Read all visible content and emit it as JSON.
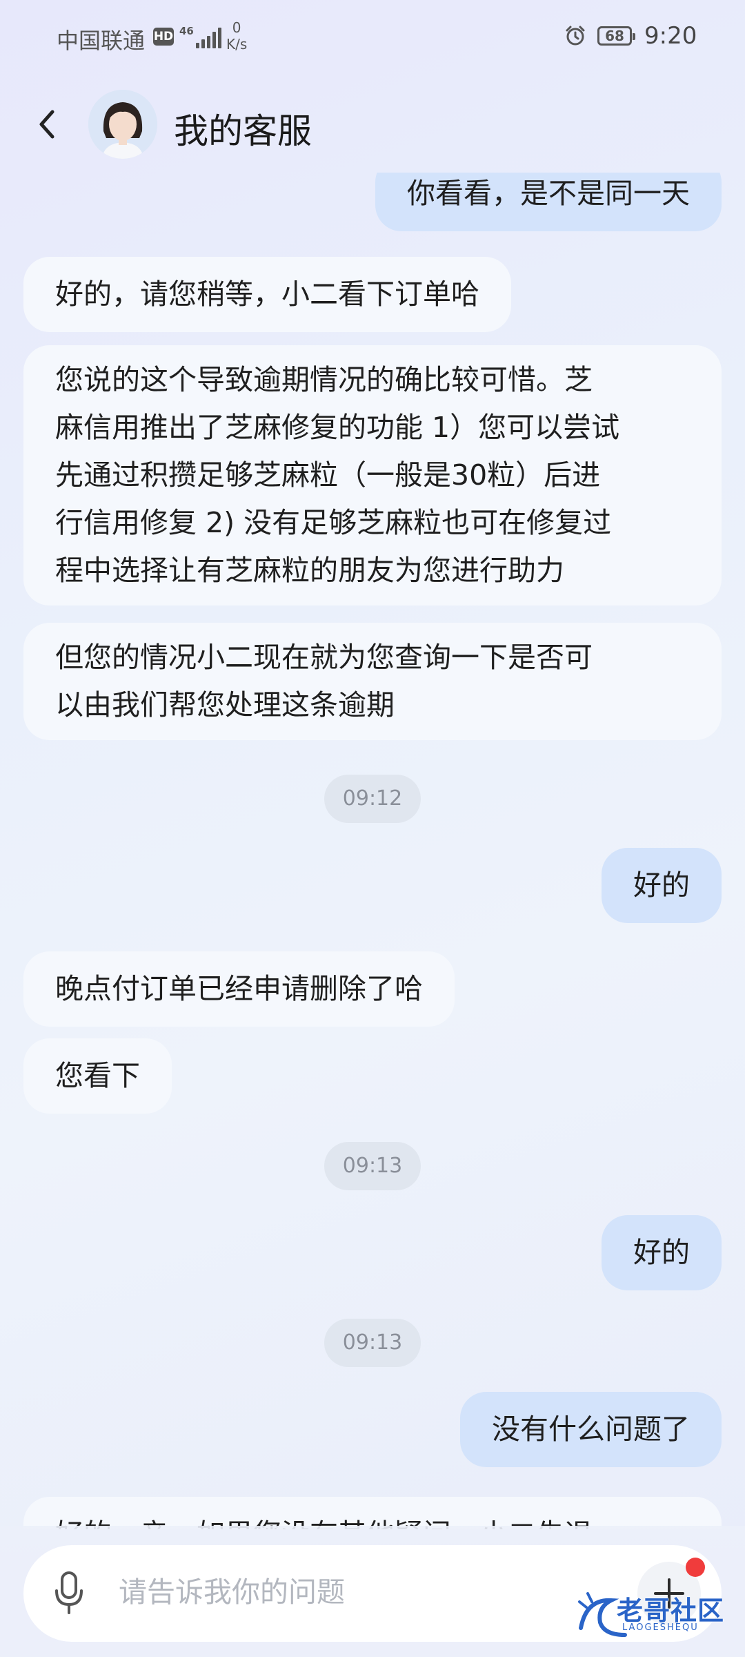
{
  "status_bar": {
    "carrier": "中国联通",
    "hd": "HD",
    "network": "46",
    "speed_value": "0",
    "speed_unit": "K/s",
    "battery": "68",
    "time": "9:20"
  },
  "header": {
    "title": "我的客服"
  },
  "messages": [
    {
      "side": "right",
      "text": "你看看，是不是同一天"
    },
    {
      "side": "left",
      "text": "好的，请您稍等，小二看下订单哈"
    },
    {
      "side": "left",
      "lines": [
        "您说的这个导致逾期情况的确比较可惜。芝",
        "麻信用推出了芝麻修复的功能 1）您可以尝试",
        "先通过积攒足够芝麻粒（一般是30粒）后进",
        "行信用修复 2) 没有足够芝麻粒也可在修复过",
        "程中选择让有芝麻粒的朋友为您进行助力"
      ]
    },
    {
      "side": "left",
      "lines": [
        "但您的情况小二现在就为您查询一下是否可",
        "以由我们帮您处理这条逾期"
      ]
    },
    {
      "type": "time",
      "text": "09:12"
    },
    {
      "side": "right",
      "text": "好的"
    },
    {
      "side": "left",
      "text": "晚点付订单已经申请删除了哈"
    },
    {
      "side": "left",
      "text": "您看下"
    },
    {
      "type": "time",
      "text": "09:13"
    },
    {
      "side": "right",
      "text": "好的"
    },
    {
      "type": "time",
      "text": "09:13"
    },
    {
      "side": "right",
      "text": "没有什么问题了"
    },
    {
      "side": "left",
      "text": "好的，亲，如果您没有其他疑问，小二先退"
    }
  ],
  "input": {
    "placeholder": "请告诉我你的问题"
  },
  "watermark": {
    "text": "老哥社区",
    "sub": "LAOGESHEQU"
  }
}
